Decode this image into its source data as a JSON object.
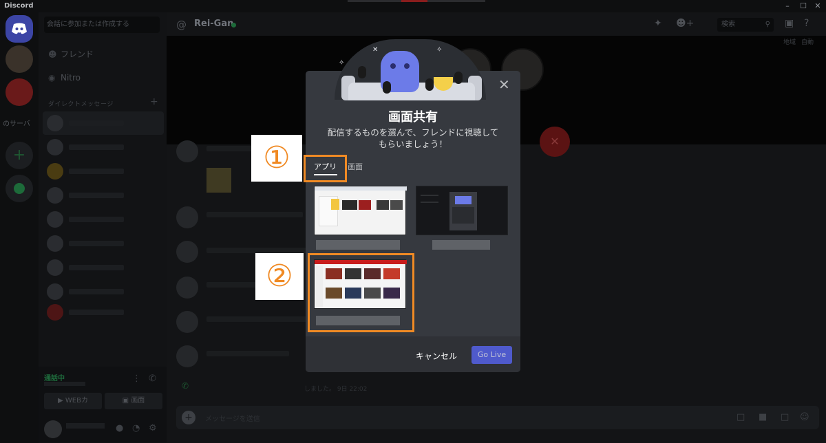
{
  "app": {
    "title": "Discord",
    "window_controls": [
      "minimize",
      "maximize",
      "close"
    ]
  },
  "sidebar": {
    "search_placeholder": "会話に参加または作成する",
    "nav": [
      "フレンド",
      "Nitro"
    ],
    "dm_header": "ダイレクトメッセージ",
    "guild_label": "のサーバ",
    "voice_status": "通話中",
    "webcam_label": "WEBカ",
    "screen_label": "画面"
  },
  "channel": {
    "name": "Rei-Gan",
    "search_placeholder": "検索",
    "sub_left": "地域",
    "sub_right": "自動"
  },
  "chat": {
    "system_text": "しました。 9日 22:02",
    "composer_placeholder": "メッセージを送信"
  },
  "modal": {
    "title": "画面共有",
    "description": "配信するものを選んで、フレンドに視聴してもらいましょう！",
    "tabs": [
      {
        "label": "アプリ",
        "selected": true
      },
      {
        "label": "画面",
        "selected": false
      }
    ],
    "sources": [
      "app-source-1",
      "app-source-2",
      "app-source-3"
    ],
    "cancel_label": "キャンセル",
    "golive_label": "Go Live",
    "accent_color": "#5865f2"
  },
  "callouts": {
    "step1": "①",
    "step2": "②",
    "color": "#f08a24"
  }
}
